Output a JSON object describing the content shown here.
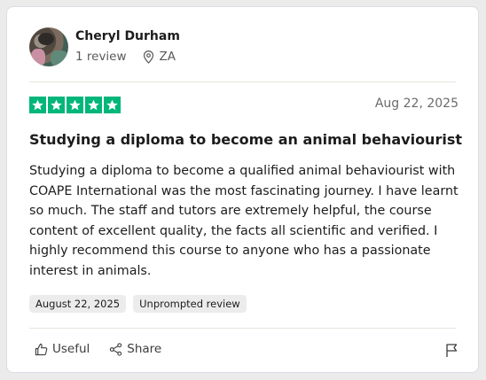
{
  "reviewer": {
    "name": "Cheryl Durham",
    "reviews": "1 review",
    "country": "ZA"
  },
  "rating": {
    "stars": 5,
    "max": 5,
    "color": "#00b67a"
  },
  "review": {
    "date": "Aug 22, 2025",
    "title": "Studying a diploma to become an animal behaviourist",
    "body": "Studying a diploma to become a qualified animal behaviourist with COAPE International was the most fascinating journey. I have learnt so much. The staff and tutors are extremely helpful, the course content of excellent quality, the facts all scientific and verified. I highly recommend this course to anyone who has a passionate interest in animals."
  },
  "tags": {
    "experience_date": "August 22, 2025",
    "source": "Unprompted review"
  },
  "actions": {
    "useful": "Useful",
    "share": "Share"
  },
  "icons": [
    "location-pin-icon",
    "star-icon",
    "thumbs-up-icon",
    "share-icon",
    "flag-icon"
  ]
}
